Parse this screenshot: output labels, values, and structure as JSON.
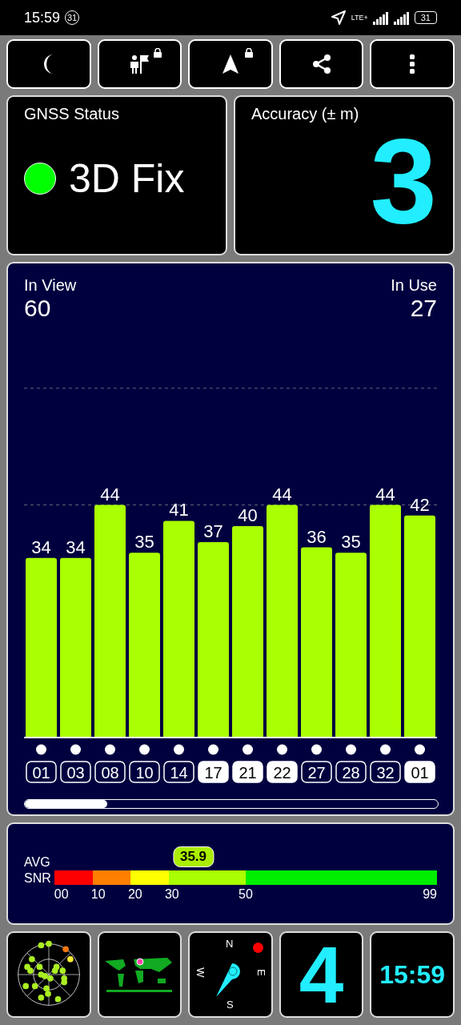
{
  "status_bar": {
    "time": "15:59",
    "notification_badge": "31",
    "network": "LTE+",
    "battery": "31"
  },
  "toolbar": [
    {
      "kind": "moon",
      "locked": false
    },
    {
      "kind": "person-flag",
      "locked": true
    },
    {
      "kind": "arrow",
      "locked": true
    },
    {
      "kind": "share",
      "locked": false
    },
    {
      "kind": "more",
      "locked": false
    }
  ],
  "gnss_status": {
    "title": "GNSS Status",
    "value": "3D Fix",
    "color": "#00ff00"
  },
  "accuracy": {
    "title": "Accuracy (± m)",
    "value": "3"
  },
  "satellites_panel": {
    "in_view_label": "In View",
    "in_view": "60",
    "in_use_label": "In Use",
    "in_use": "27",
    "chart_data": {
      "type": "bar",
      "categories": [
        "01",
        "03",
        "08",
        "10",
        "14",
        "17",
        "21",
        "22",
        "27",
        "28",
        "32",
        "01"
      ],
      "series": [
        {
          "color": "#aaff00",
          "values": [
            34,
            34,
            44,
            35,
            41,
            37,
            40,
            44,
            36,
            35,
            44,
            42
          ]
        }
      ],
      "data_labels": true
    },
    "satellites": [
      {
        "used": false
      },
      {
        "used": false
      },
      {
        "used": false
      },
      {
        "used": false
      },
      {
        "used": false
      },
      {
        "used": true
      },
      {
        "used": true
      },
      {
        "used": true
      },
      {
        "used": false
      },
      {
        "used": false
      },
      {
        "used": false
      },
      {
        "used": true
      }
    ]
  },
  "snr_panel": {
    "label": "AVG\nSNR",
    "average": "35.9",
    "level": 0.363,
    "segments": [
      {
        "label": "00",
        "color": "#ff0000"
      },
      {
        "label": "10",
        "color": "#ff8000"
      },
      {
        "label": "20",
        "color": "#ffff00"
      },
      {
        "label": "30",
        "color": "#aaff00"
      },
      {
        "label": "50",
        "color": "#00ee00"
      }
    ],
    "end_label": "99"
  },
  "bottom_tiles": [
    {
      "kind": "radar"
    },
    {
      "kind": "map"
    },
    {
      "kind": "compass",
      "north": "N",
      "east": "E",
      "south": "S",
      "west": "W"
    },
    {
      "kind": "number",
      "value": "4"
    },
    {
      "kind": "clock",
      "value": "15:59"
    }
  ]
}
